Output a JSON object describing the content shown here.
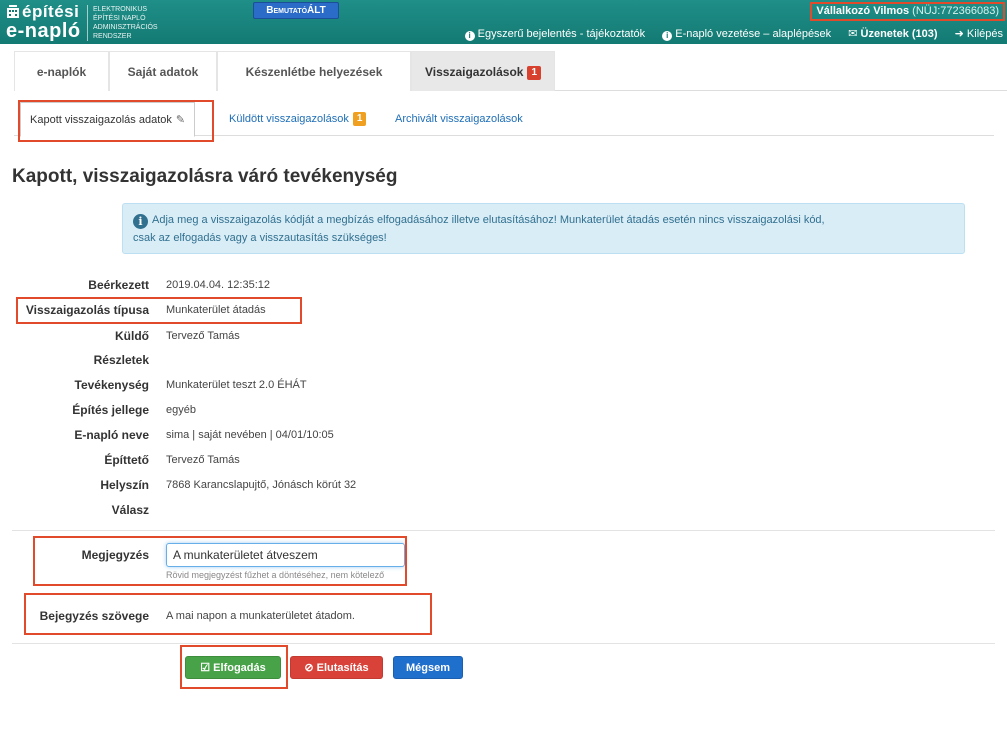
{
  "header": {
    "logo_top": "építési",
    "logo_bottom": "e-napló",
    "logo_sub": [
      "Elektronikus",
      "Építési napló",
      "Adminisztrációs",
      "Rendszer"
    ],
    "demo_label": "BemutatóÁLT",
    "user_name": "Vállalkozó Vilmos",
    "user_id": "(NÜJ:772366083)",
    "links": {
      "simple_report": "Egyszerű bejelentés - tájékoztatók",
      "basics": "E-napló vezetése – alaplépések",
      "messages": "Üzenetek (103)",
      "logout": "Kilépés"
    }
  },
  "main_tabs": [
    {
      "label": "e-naplók"
    },
    {
      "label": "Saját adatok"
    },
    {
      "label": "Készenlétbe helyezések"
    },
    {
      "label": "Visszaigazolások",
      "badge": "1"
    }
  ],
  "sub_tabs": [
    {
      "label": "Kapott visszaigazolás adatok"
    },
    {
      "label": "Küldött visszaigazolások",
      "badge": "1"
    },
    {
      "label": "Archivált visszaigazolások"
    }
  ],
  "page_title": "Kapott, visszaigazolásra váró tevékenység",
  "info_text_1": "Adja meg a visszaigazolás kódját a megbízás elfogadásához illetve elutasításához! Munkaterület átadás esetén nincs visszaigazolási kód,",
  "info_text_2": "csak az elfogadás vagy a visszautasítás szükséges!",
  "details": [
    {
      "label": "Beérkezett",
      "value": "2019.04.04. 12:35:12"
    },
    {
      "label": "Visszaigazolás típusa",
      "value": "Munkaterület átadás"
    },
    {
      "label": "Küldő",
      "value": "Tervező Tamás"
    },
    {
      "label": "Részletek",
      "value": ""
    },
    {
      "label": "Tevékenység",
      "value": "Munkaterület teszt 2.0 ÉHÁT"
    },
    {
      "label": "Építés jellege",
      "value": "egyéb"
    },
    {
      "label": "E-napló neve",
      "value": "sima | saját nevében | 04/01/10:05"
    },
    {
      "label": "Építtető",
      "value": "Tervező Tamás"
    },
    {
      "label": "Helyszín",
      "value": "7868 Karancslapujtő, Jónásch körút 32"
    },
    {
      "label": "Válasz",
      "value": ""
    }
  ],
  "note": {
    "label": "Megjegyzés",
    "value": "A munkaterületet átveszem",
    "help": "Rövid megjegyzést fűzhet a döntéséhez, nem kötelező"
  },
  "entry": {
    "label": "Bejegyzés szövege",
    "value": "A mai napon a munkaterületet átadom."
  },
  "buttons": {
    "accept": "Elfogadás",
    "reject": "Elutasítás",
    "cancel": "Mégsem"
  }
}
